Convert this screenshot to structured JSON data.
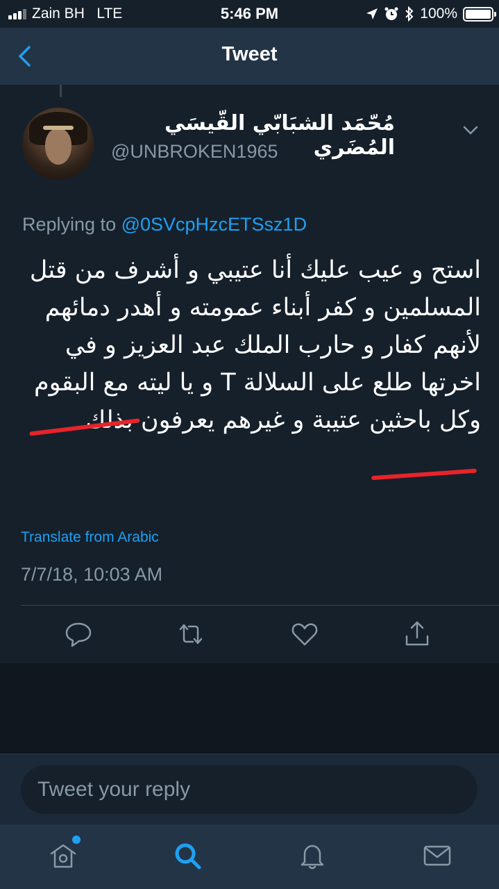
{
  "status_bar": {
    "carrier": "Zain BH   LTE",
    "time": "5:46 PM",
    "battery": "100%"
  },
  "nav": {
    "title": "Tweet"
  },
  "tweet": {
    "display_name": "مُحّمَد الشبَابّي القّيسَي المُضَري",
    "handle": "@UNBROKEN1965",
    "replying_prefix": "Replying to ",
    "replying_to": "@0SVcpHzcETSsz1D",
    "text": "استح و عيب عليك أنا عتيبي و أشرف من قتل المسلمين و كفر أبناء عمومته و أهدر دمائهم لأنهم كفار و حارب الملك عبد العزيز و في اخرتها طلع على السلالة T و يا ليته مع البقوم وكل باحثين عتيبة و غيرهم يعرفون بذلك",
    "translate_label": "Translate from Arabic",
    "timestamp": "7/7/18, 10:03 AM"
  },
  "icons": {
    "back": "chevron-left-icon",
    "more": "chevron-down-icon",
    "reply": "reply-icon",
    "retweet": "retweet-icon",
    "like": "heart-icon",
    "share": "share-icon",
    "home": "home-icon",
    "search": "search-icon",
    "notifications": "bell-icon",
    "messages": "mail-icon"
  },
  "reply_bar": {
    "placeholder": "Tweet your reply"
  },
  "colors": {
    "background": "#15202b",
    "header": "#243447",
    "accent": "#1da1f2",
    "secondary_text": "#8899a6",
    "annotation": "#e8232a"
  }
}
